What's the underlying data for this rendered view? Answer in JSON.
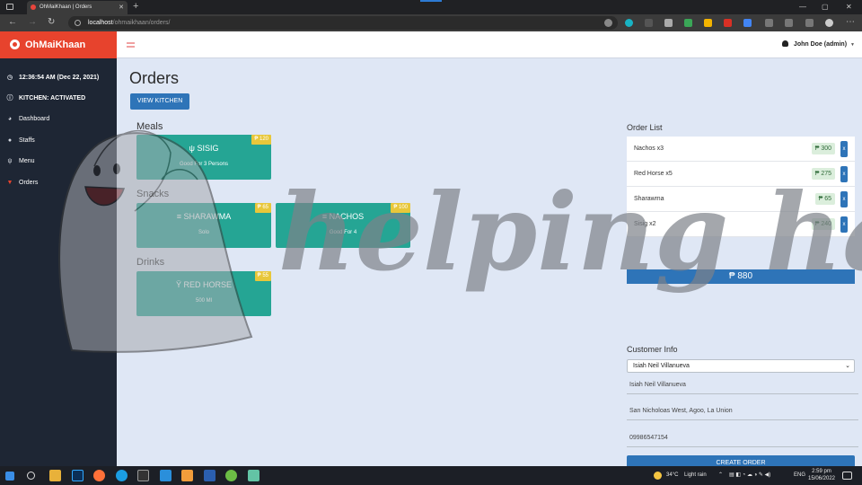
{
  "browser": {
    "tab_title": "OhMaiKhaan | Orders",
    "url_host": "localhost",
    "url_path": "/ohmaikhaan/orders/"
  },
  "app": {
    "brand": "OhMaiKhaan",
    "user": "John Doe (admin)"
  },
  "sidebar": {
    "clock": "12:36:54 AM (Dec 22, 2021)",
    "kitchen_status": "KITCHEN: ACTIVATED",
    "items": [
      {
        "label": "Dashboard",
        "icon": "dashboard-icon"
      },
      {
        "label": "Staffs",
        "icon": "user-icon"
      },
      {
        "label": "Menu",
        "icon": "fork-knife-icon"
      },
      {
        "label": "Orders",
        "icon": "cart-icon"
      }
    ]
  },
  "main": {
    "title": "Orders",
    "view_kitchen_label": "VIEW KITCHEN",
    "sections": {
      "meals": "Meals",
      "snacks": "Snacks",
      "drinks": "Drinks"
    },
    "cards": {
      "sisig": {
        "name": "SISIG",
        "desc": "Good For 3 Persons",
        "price": "₱ 120"
      },
      "sharawma": {
        "name": "SHARAWMA",
        "desc": "Solo",
        "price": "₱ 65"
      },
      "nachos": {
        "name": "NACHOS",
        "desc": "Good For 4",
        "price": "₱ 100"
      },
      "red_horse": {
        "name": "RED HORSE",
        "desc": "500 Ml",
        "price": "₱ 55"
      }
    }
  },
  "order_list": {
    "title": "Order List",
    "items": [
      {
        "name": "Nachos x3",
        "price": "₱ 300",
        "remove": "x"
      },
      {
        "name": "Red Horse x5",
        "price": "₱ 275",
        "remove": "x"
      },
      {
        "name": "Sharawma",
        "price": "₱ 65",
        "remove": "x"
      },
      {
        "name": "Sisig x2",
        "price": "₱ 240",
        "remove": "x"
      }
    ],
    "total": "₱ 880"
  },
  "customer_info": {
    "title": "Customer Info",
    "selected_customer": "Isiah Neil Villanueva",
    "name": "Isiah Neil Villanueva",
    "address": "San Nicholoas West, Agoo, La Union",
    "phone": "09986547154",
    "create_label": "CREATE ORDER"
  },
  "watermark": {
    "text": "helping hand"
  },
  "taskbar": {
    "temperature": "34°C",
    "weather": "Light rain",
    "language": "ENG",
    "time": "2:59 pm",
    "date": "15/06/2022"
  },
  "colors": {
    "brand": "#e7432d",
    "card": "#25a594",
    "primary": "#2e74b8",
    "sidebar": "#1e2634",
    "badge": "#e8c73a"
  }
}
